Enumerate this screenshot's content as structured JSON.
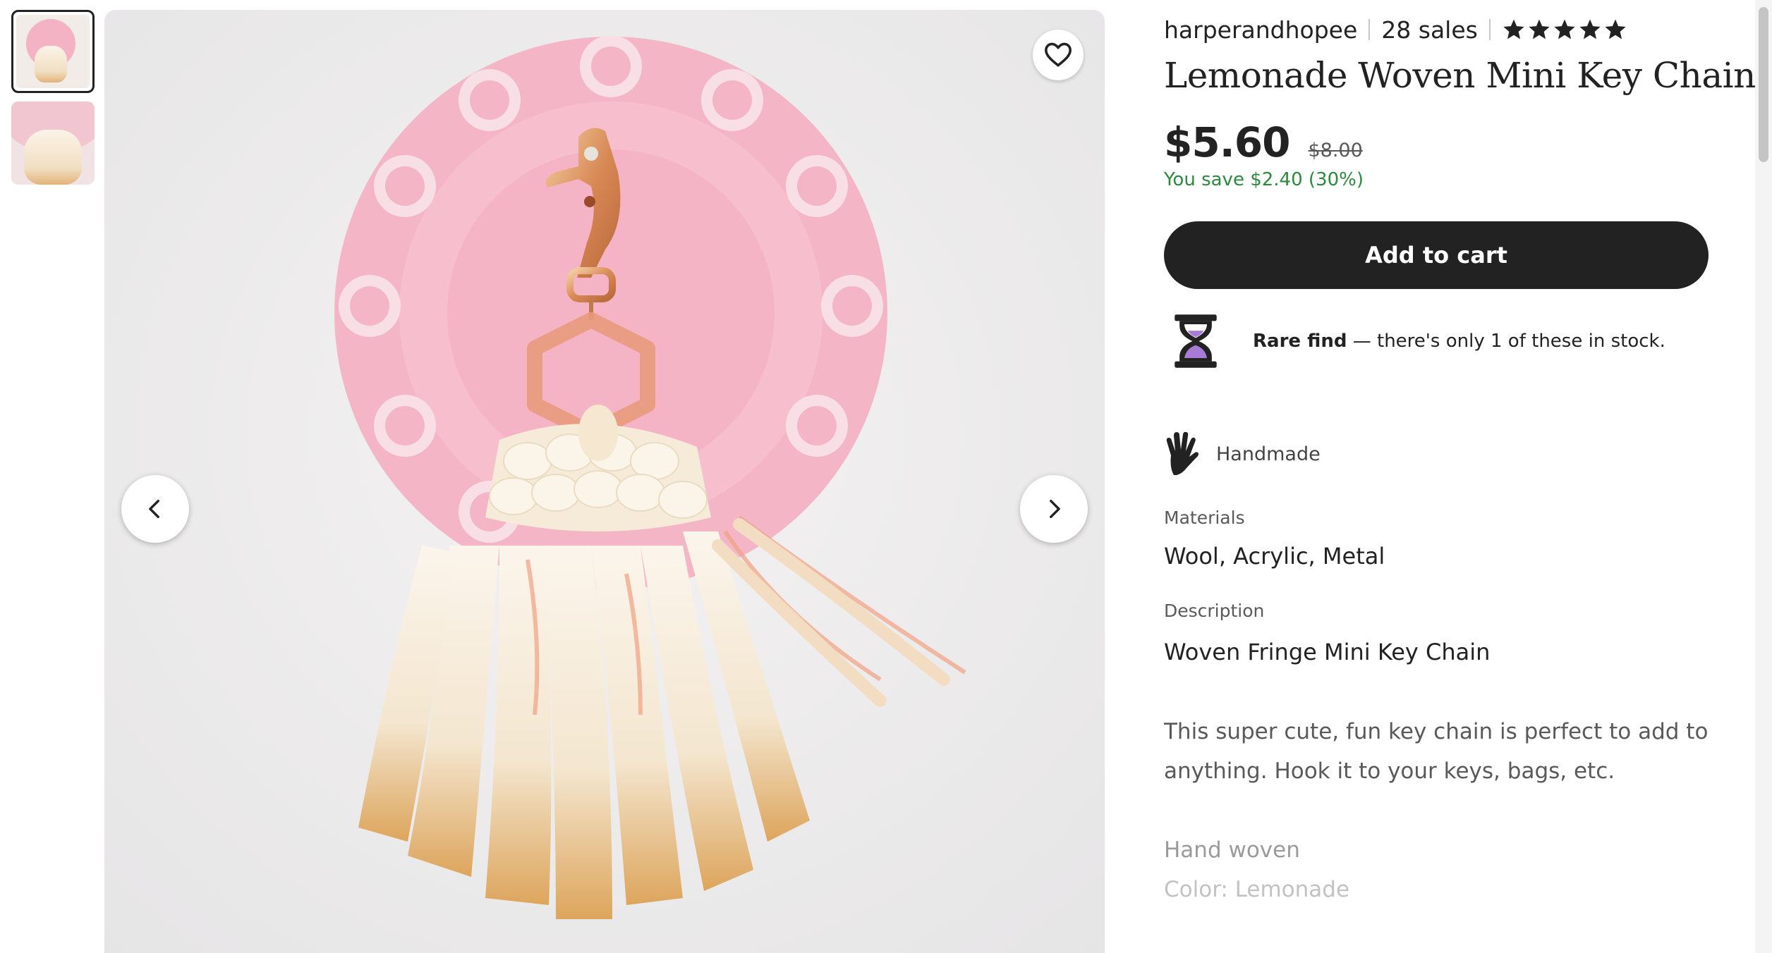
{
  "thumbnails": [
    {
      "alt": "Listing image 1",
      "active": true
    },
    {
      "alt": "Listing image 2",
      "active": false
    }
  ],
  "main_image": {
    "prev_icon": "chevron-left-icon",
    "next_icon": "chevron-right-icon",
    "favorite_icon": "heart-icon"
  },
  "shop": {
    "name": "harperandhopee",
    "sales": "28 sales",
    "rating_stars": 5
  },
  "listing": {
    "title": "Lemonade Woven Mini Key Chain",
    "price": "$5.60",
    "original_price": "$8.00",
    "savings": "You save $2.40 (30%)",
    "add_to_cart": "Add to cart"
  },
  "stock_notice": {
    "bold": "Rare find",
    "text": " — there's only 1 of these in stock.",
    "icon": "hourglass-icon"
  },
  "highlights": {
    "handmade": "Handmade",
    "handmade_icon": "hand-icon"
  },
  "materials": {
    "label": "Materials",
    "value": "Wool, Acrylic, Metal"
  },
  "description": {
    "label": "Description",
    "heading": "Woven Fringe Mini Key Chain",
    "paragraph": "This super cute, fun key chain is perfect to add to anything. Hook it to your keys, bags, etc.",
    "line1": "Hand woven",
    "line2": "Color: Lemonade"
  },
  "colors": {
    "primary_button": "#222222",
    "savings_green": "#2b8a3e",
    "doily_pink": "#f3b3c4"
  }
}
